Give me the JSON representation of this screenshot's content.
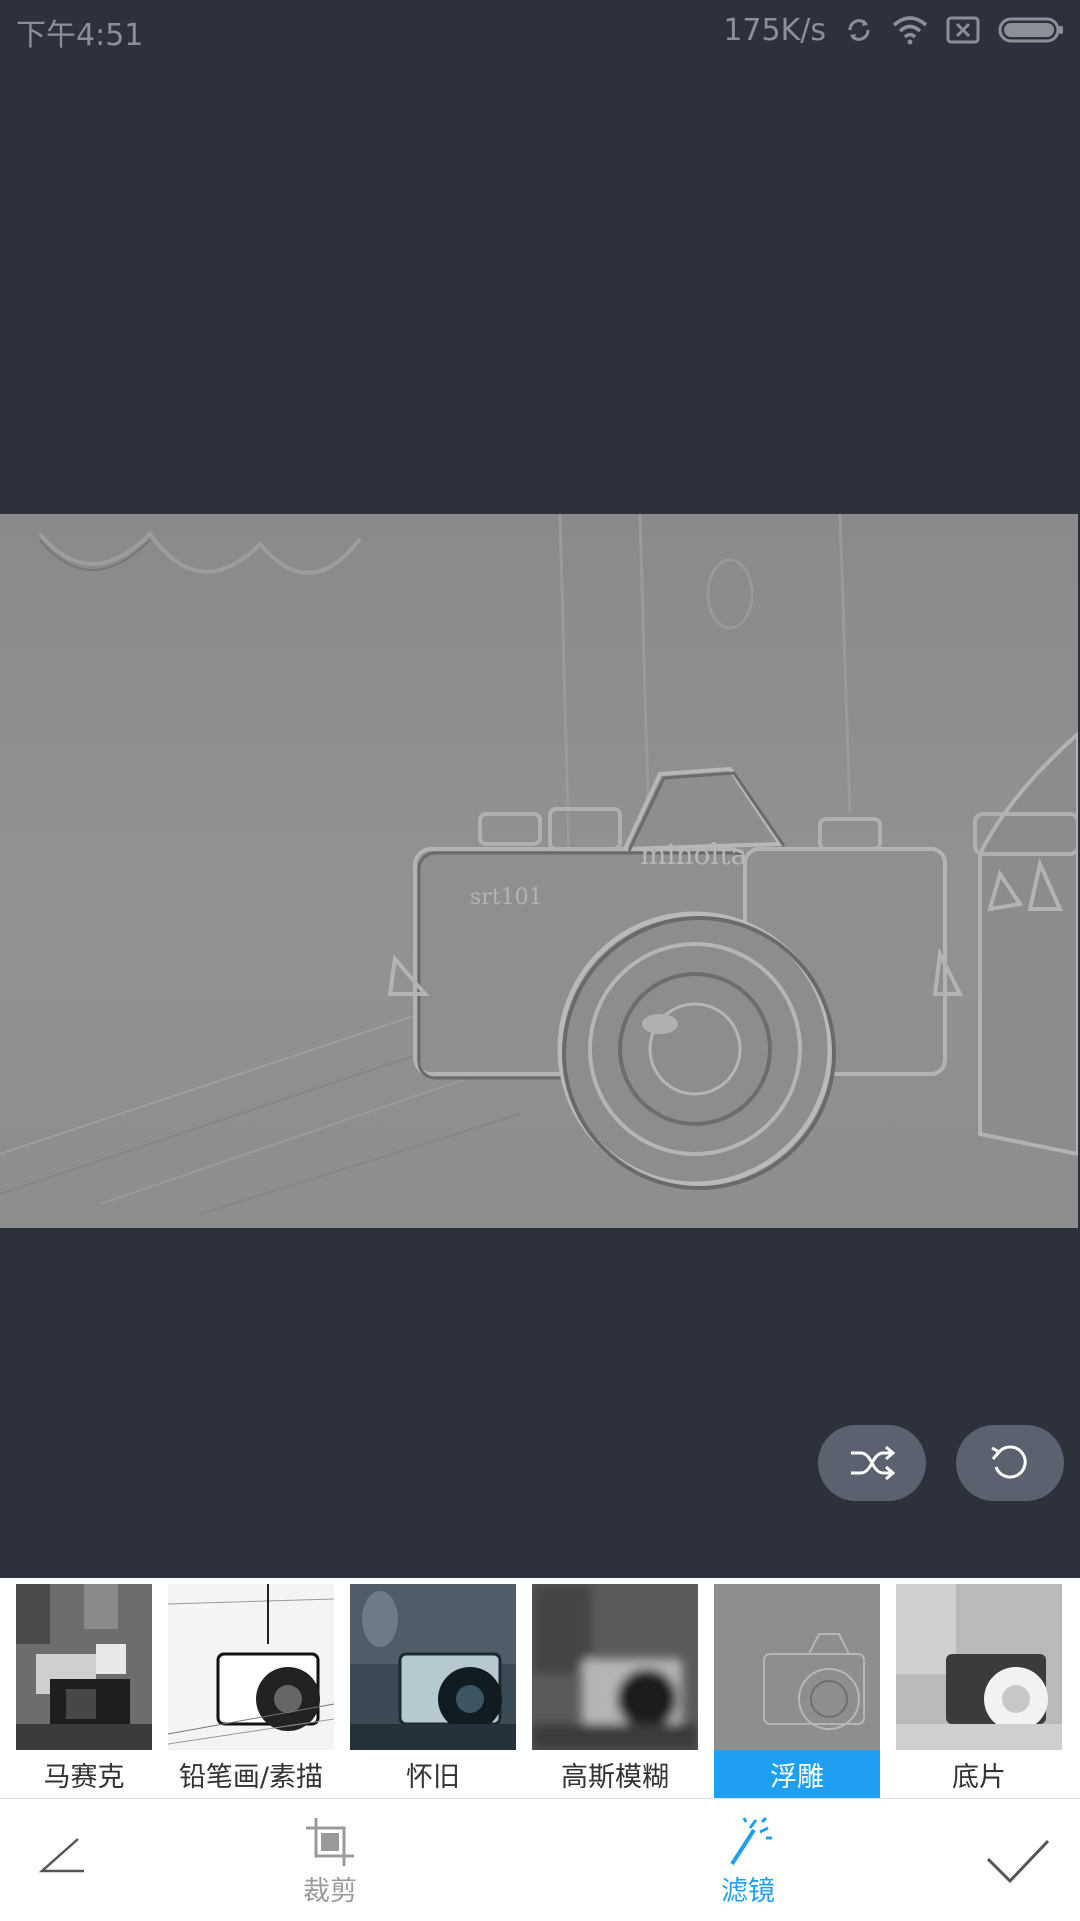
{
  "status_bar": {
    "time": "下午4:51",
    "speed": "175K/s",
    "icons": [
      "sync-icon",
      "wifi-icon",
      "sim-icon",
      "battery-icon"
    ]
  },
  "preview": {
    "image": "embossed-camera-photo",
    "description": "embossed-filter-photo-of-film-camera"
  },
  "controls": {
    "shuffle": "shuffle-icon",
    "reset": "rotate-reset-icon"
  },
  "filters": [
    {
      "label": "马赛克",
      "thumb": "mosaic"
    },
    {
      "label": "铅笔画/素描",
      "thumb": "sketch"
    },
    {
      "label": "怀旧",
      "thumb": "vintage"
    },
    {
      "label": "高斯模糊",
      "thumb": "blur"
    },
    {
      "label": "浮雕",
      "thumb": "emboss",
      "selected": true
    },
    {
      "label": "底片",
      "thumb": "negative"
    }
  ],
  "toolbar": {
    "crop_label": "裁剪",
    "filter_label": "滤镜",
    "active_tab": "滤镜"
  },
  "colors": {
    "background": "#2d313c",
    "accent": "#1e9ff2",
    "button": "#5c6170"
  }
}
